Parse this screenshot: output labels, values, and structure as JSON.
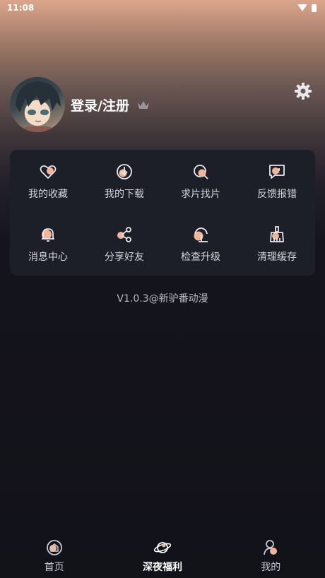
{
  "status_bar": {
    "time": "11:08"
  },
  "profile": {
    "login_label": "登录/注册"
  },
  "menu": {
    "items": [
      {
        "label": "我的收藏",
        "icon": "heart-icon"
      },
      {
        "label": "我的下载",
        "icon": "download-icon"
      },
      {
        "label": "求片找片",
        "icon": "search-film-icon"
      },
      {
        "label": "反馈报错",
        "icon": "feedback-icon"
      },
      {
        "label": "消息中心",
        "icon": "bell-icon"
      },
      {
        "label": "分享好友",
        "icon": "share-icon"
      },
      {
        "label": "检查升级",
        "icon": "upgrade-icon"
      },
      {
        "label": "清理缓存",
        "icon": "broom-icon"
      }
    ]
  },
  "version": "V1.0.3@新驴番动漫",
  "bottom_nav": {
    "items": [
      {
        "label": "首页",
        "icon": "home-icon"
      },
      {
        "label": "深夜福利",
        "icon": "planet-icon"
      },
      {
        "label": "我的",
        "icon": "profile-icon"
      }
    ],
    "active": "深夜福利"
  },
  "colors": {
    "accent": "#f2b59a",
    "card": "#1c1e28",
    "line": "#e8e8ee"
  }
}
